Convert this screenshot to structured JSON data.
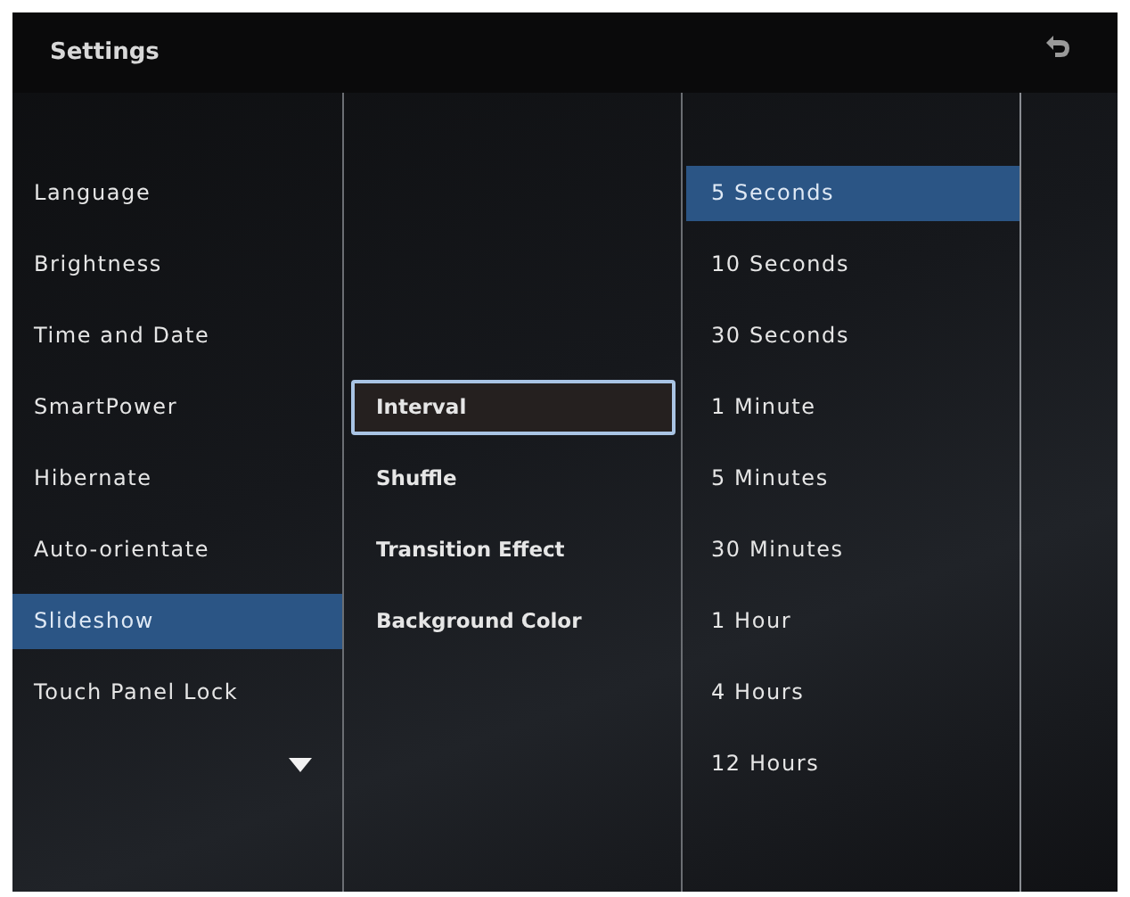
{
  "window": {
    "title": "Settings"
  },
  "categories": [
    {
      "label": "Language",
      "selected": false
    },
    {
      "label": "Brightness",
      "selected": false
    },
    {
      "label": "Time and Date",
      "selected": false
    },
    {
      "label": "SmartPower",
      "selected": false
    },
    {
      "label": "Hibernate",
      "selected": false
    },
    {
      "label": "Auto-orientate",
      "selected": false
    },
    {
      "label": "Slideshow",
      "selected": true
    },
    {
      "label": "Touch Panel Lock",
      "selected": false
    }
  ],
  "options": [
    {
      "label": "Interval",
      "selected": true
    },
    {
      "label": "Shuffle",
      "selected": false
    },
    {
      "label": "Transition Effect",
      "selected": false
    },
    {
      "label": "Background Color",
      "selected": false
    }
  ],
  "values": [
    {
      "label": "5 Seconds",
      "selected": true
    },
    {
      "label": "10 Seconds",
      "selected": false
    },
    {
      "label": "30 Seconds",
      "selected": false
    },
    {
      "label": "1 Minute",
      "selected": false
    },
    {
      "label": "5 Minutes",
      "selected": false
    },
    {
      "label": "30 Minutes",
      "selected": false
    },
    {
      "label": "1 Hour",
      "selected": false
    },
    {
      "label": "4 Hours",
      "selected": false
    },
    {
      "label": "12 Hours",
      "selected": false
    }
  ]
}
